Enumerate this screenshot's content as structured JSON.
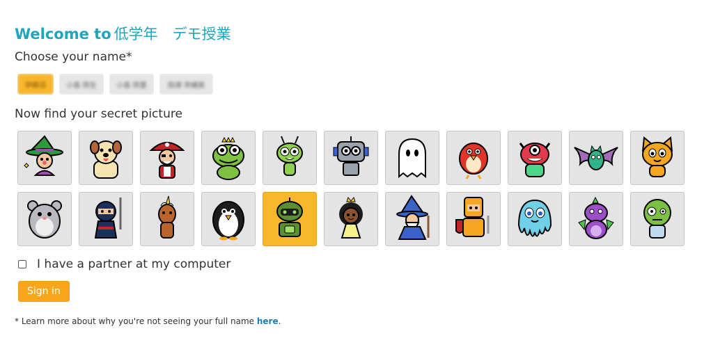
{
  "header": {
    "welcome": "Welcome to",
    "class_name": "低学年　デモ授業"
  },
  "name_prompt": "Choose your name*",
  "names": [
    {
      "label": "伊藤沼",
      "selected": true
    },
    {
      "label": "小島 弥生",
      "selected": false
    },
    {
      "label": "小島 弥里",
      "selected": false
    },
    {
      "label": "田津 奈緒実",
      "selected": false
    }
  ],
  "picture_prompt": "Now find your secret picture",
  "pictures": [
    {
      "icon": "witch-icon",
      "selected": false
    },
    {
      "icon": "dog-icon",
      "selected": false
    },
    {
      "icon": "pirate-icon",
      "selected": false
    },
    {
      "icon": "frog-prince-icon",
      "selected": false
    },
    {
      "icon": "alien-icon",
      "selected": false
    },
    {
      "icon": "robot-icon",
      "selected": false
    },
    {
      "icon": "ghost-icon",
      "selected": false
    },
    {
      "icon": "red-bird-icon",
      "selected": false
    },
    {
      "icon": "red-monster-icon",
      "selected": false
    },
    {
      "icon": "bat-icon",
      "selected": false
    },
    {
      "icon": "orange-cat-icon",
      "selected": false
    },
    {
      "icon": "hamster-icon",
      "selected": false
    },
    {
      "icon": "ninja-icon",
      "selected": false
    },
    {
      "icon": "unicorn-icon",
      "selected": false
    },
    {
      "icon": "penguin-icon",
      "selected": false
    },
    {
      "icon": "green-robot-icon",
      "selected": true
    },
    {
      "icon": "princess-icon",
      "selected": false
    },
    {
      "icon": "wizard-icon",
      "selected": false
    },
    {
      "icon": "knight-icon",
      "selected": false
    },
    {
      "icon": "octopus-icon",
      "selected": false
    },
    {
      "icon": "dragon-icon",
      "selected": false
    },
    {
      "icon": "zombie-icon",
      "selected": false
    }
  ],
  "partner": {
    "label": "I have a partner at my computer",
    "checked": false
  },
  "signin": {
    "label": "Sign in"
  },
  "footnote": {
    "text": "* Learn more about why you're not seeing your full name ",
    "link": "here",
    "end": "."
  },
  "colors": {
    "accent": "#1fa6bd",
    "selected": "#f9b72b",
    "button": "#f9a61a",
    "tile": "#e4e4e4"
  }
}
